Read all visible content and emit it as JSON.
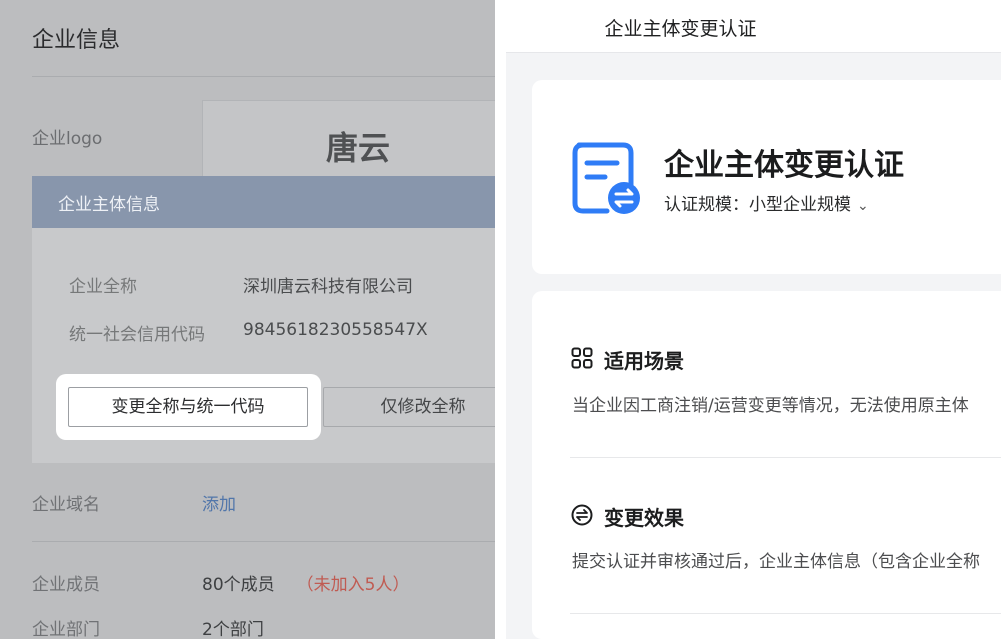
{
  "background_page": {
    "title": "企业信息",
    "logo_label": "企业logo",
    "logo_text": "唐云",
    "modal": {
      "title": "企业主体信息",
      "full_name_label": "企业全称",
      "full_name_value": "深圳唐云科技有限公司",
      "credit_code_label": "统一社会信用代码",
      "credit_code_value": "9845618230558547X",
      "primary_button": "变更全称与统一代码",
      "secondary_button": "仅修改全称"
    },
    "domain_label": "企业域名",
    "domain_action": "添加",
    "members_label": "企业成员",
    "members_value": "80个成员",
    "members_pending": "（未加入5人）",
    "departments_label": "企业部门",
    "departments_value": "2个部门"
  },
  "panel": {
    "header_title": "企业主体变更认证",
    "card_title": "企业主体变更认证",
    "scale_label": "认证规模：",
    "scale_value": "小型企业规模",
    "section1_title": "适用场景",
    "section1_text": "当企业因工商注销/运营变更等情况，无法使用原主体",
    "section2_title": "变更效果",
    "section2_text": "提交认证并审核通过后，企业主体信息（包含企业全称"
  },
  "colors": {
    "accent": "#2f7cf6",
    "link": "#5176aa",
    "pending": "#c05b52",
    "modal_header": "#8896ac"
  },
  "icons": [
    "document-exchange-icon",
    "grid-apps-icon",
    "swap-circle-icon",
    "chevron-down-icon"
  ]
}
